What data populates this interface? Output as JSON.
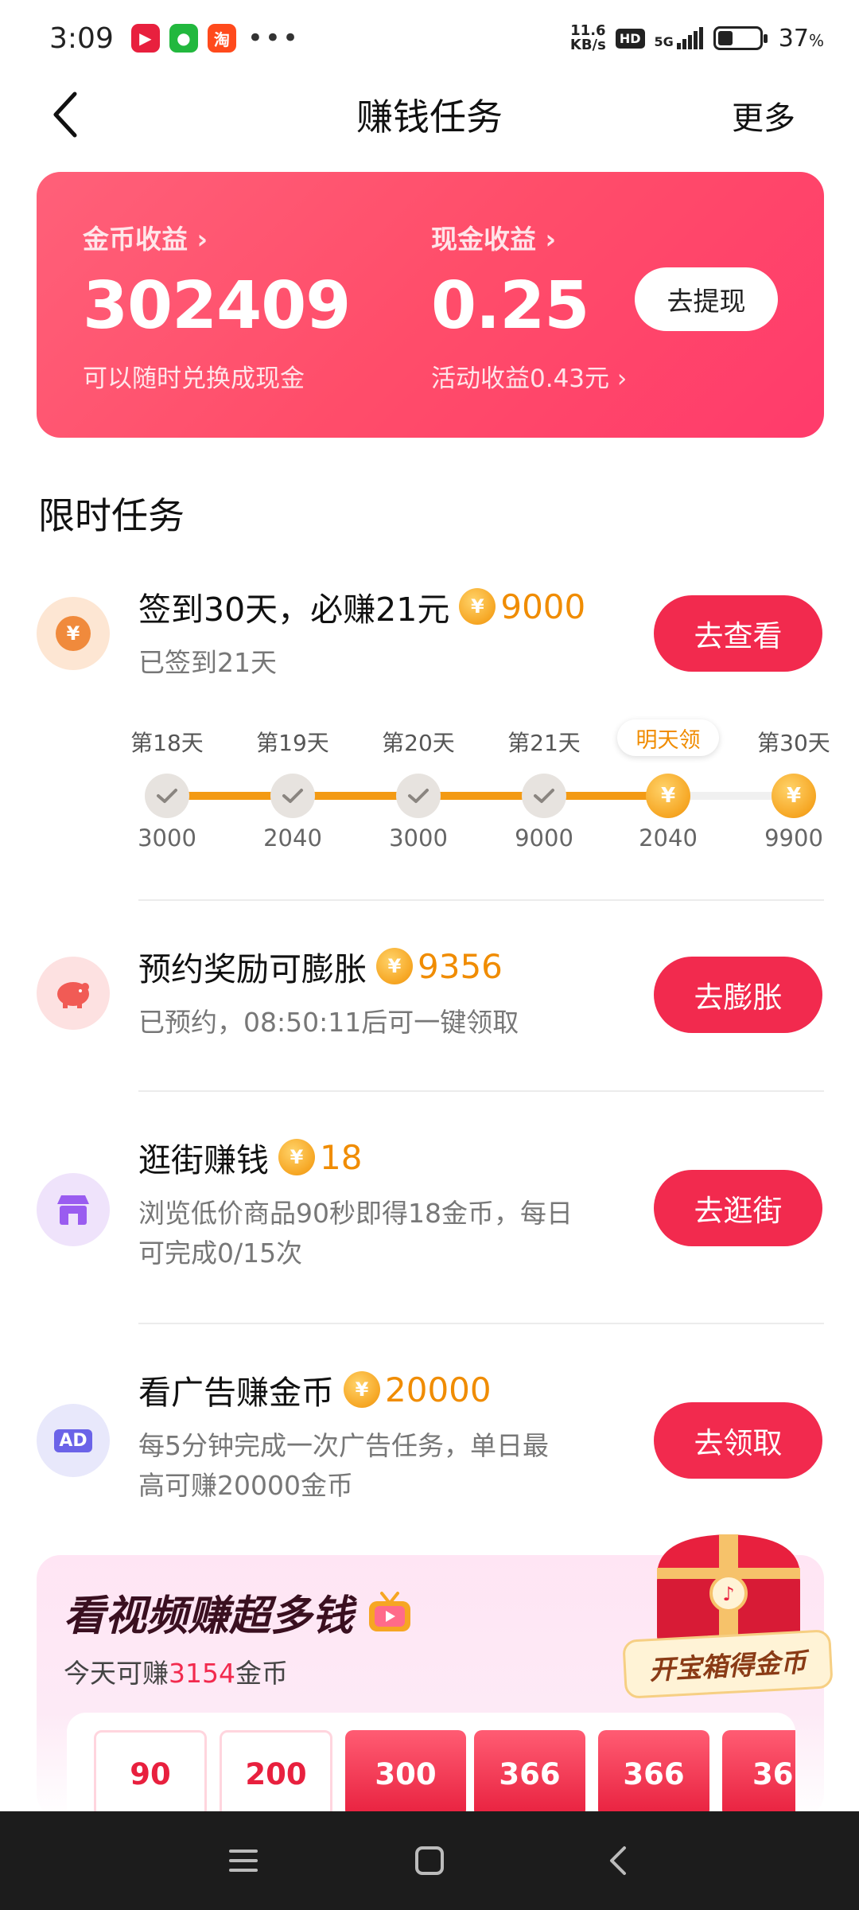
{
  "status_bar": {
    "time": "3:09",
    "network_speed_top": "11.6",
    "network_speed_bottom": "KB/s",
    "hd_badge": "HD",
    "signal_label": "5G",
    "battery_percent": "37",
    "battery_unit": "%",
    "app_icons": [
      {
        "name": "video-app-icon",
        "color": "#e8203e"
      },
      {
        "name": "wechat-icon",
        "color": "#22b83e"
      },
      {
        "name": "taobao-icon",
        "color": "#ff4a1c"
      }
    ],
    "more_dots": "•••"
  },
  "header": {
    "title": "赚钱任务",
    "more_label": "更多"
  },
  "earnings": {
    "coin_label": "金币收益 ›",
    "coin_value": "302409",
    "coin_sub": "可以随时兑换成现金",
    "cash_label": "现金收益 ›",
    "cash_value": "0.25",
    "cash_sub": "活动收益0.43元 ›",
    "withdraw_label": "去提现"
  },
  "section": {
    "title": "限时任务"
  },
  "tasks": [
    {
      "title": "签到30天，必赚21元",
      "coin_amount": "9000",
      "desc": "已签到21天",
      "button": "去查看"
    },
    {
      "title": "预约奖励可膨胀",
      "coin_amount": "9356",
      "desc": "已预约，08:50:11后可一键领取",
      "button": "去膨胀"
    },
    {
      "title": "逛街赚钱",
      "coin_amount": "18",
      "desc_line1": "浏览低价商品90秒即得18金币，每日",
      "desc_line2": "可完成0/15次",
      "button": "去逛街"
    },
    {
      "title": "看广告赚金币",
      "coin_amount": "20000",
      "desc_line1": "每5分钟完成一次广告任务，单日最",
      "desc_line2": "高可赚20000金币",
      "button": "去领取",
      "icon_text": "AD"
    }
  ],
  "checkin_progress": {
    "days": [
      "第18天",
      "第19天",
      "第20天",
      "第21天",
      "明天领",
      "第30天"
    ],
    "amounts": [
      "3000",
      "2040",
      "3000",
      "9000",
      "2040",
      "9900"
    ],
    "completed_count": 4
  },
  "coin_symbol": "¥",
  "video_card": {
    "title": "看视频赚超多钱",
    "sub_prefix": "今天可赚",
    "sub_highlight": "3154",
    "sub_suffix": "金币",
    "treasure_label": "开宝箱得金币",
    "rewards": [
      "90",
      "200",
      "300",
      "366",
      "366",
      "36"
    ]
  },
  "colors": {
    "accent_red": "#f22a4e",
    "coin_orange": "#f08c00",
    "progress_orange": "#f39a14"
  }
}
